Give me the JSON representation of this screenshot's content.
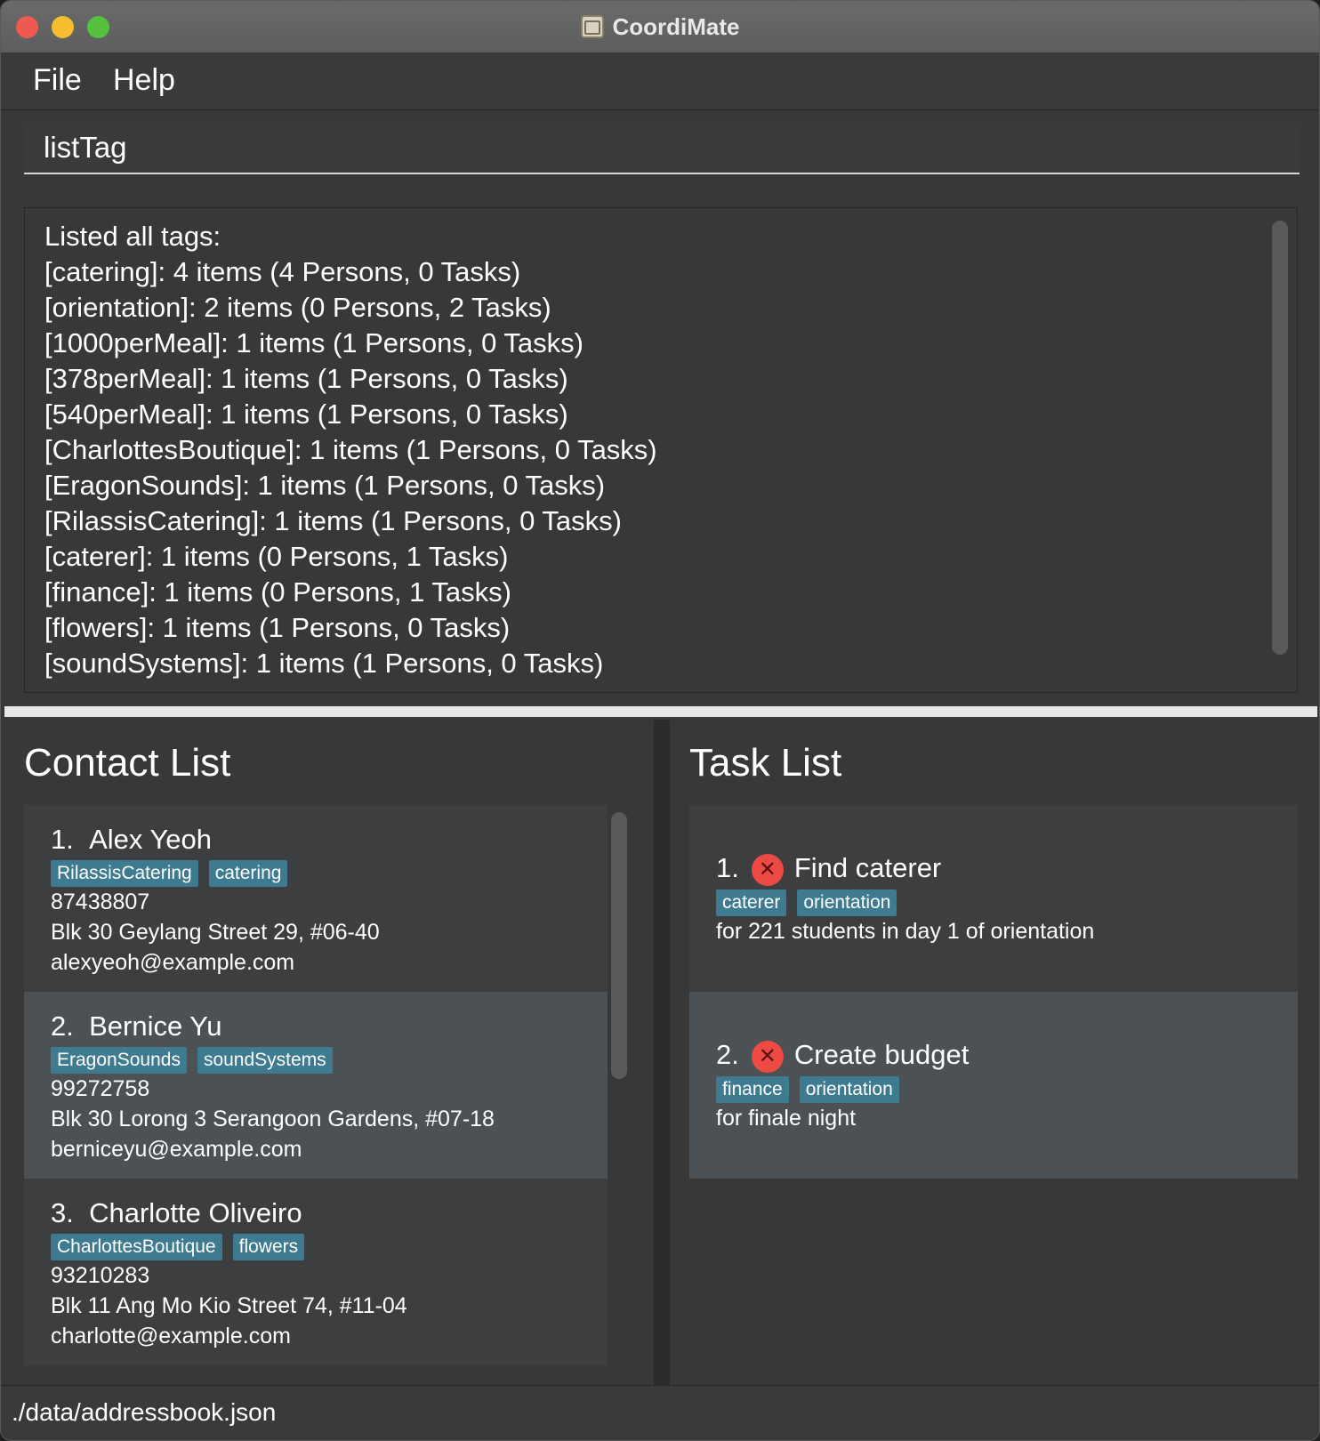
{
  "window": {
    "title": "CoordiMate"
  },
  "menu": {
    "file": "File",
    "help": "Help"
  },
  "command": {
    "value": "listTag"
  },
  "result": {
    "lines": [
      "Listed all tags:",
      "[catering]: 4 items (4 Persons, 0 Tasks)",
      "[orientation]: 2 items (0 Persons, 2 Tasks)",
      "[1000perMeal]: 1 items (1 Persons, 0 Tasks)",
      "[378perMeal]: 1 items (1 Persons, 0 Tasks)",
      "[540perMeal]: 1 items (1 Persons, 0 Tasks)",
      "[CharlottesBoutique]: 1 items (1 Persons, 0 Tasks)",
      "[EragonSounds]: 1 items (1 Persons, 0 Tasks)",
      "[RilassisCatering]: 1 items (1 Persons, 0 Tasks)",
      "[caterer]: 1 items (0 Persons, 1 Tasks)",
      "[finance]: 1 items (0 Persons, 1 Tasks)",
      "[flowers]: 1 items (1 Persons, 0 Tasks)",
      "[soundSystems]: 1 items (1 Persons, 0 Tasks)"
    ]
  },
  "contacts": {
    "title": "Contact List",
    "items": [
      {
        "index": "1.",
        "name": "Alex Yeoh",
        "tags": [
          "RilassisCatering",
          "catering"
        ],
        "phone": "87438807",
        "address": "Blk 30 Geylang Street 29, #06-40",
        "email": "alexyeoh@example.com"
      },
      {
        "index": "2.",
        "name": "Bernice Yu",
        "tags": [
          "EragonSounds",
          "soundSystems"
        ],
        "phone": "99272758",
        "address": "Blk 30 Lorong 3 Serangoon Gardens, #07-18",
        "email": "berniceyu@example.com"
      },
      {
        "index": "3.",
        "name": "Charlotte Oliveiro",
        "tags": [
          "CharlottesBoutique",
          "flowers"
        ],
        "phone": "93210283",
        "address": "Blk 11 Ang Mo Kio Street 74, #11-04",
        "email": "charlotte@example.com"
      }
    ]
  },
  "tasks": {
    "title": "Task List",
    "status_icon": "cross-circle-icon",
    "status_color": "#ee4a44",
    "items": [
      {
        "index": "1.",
        "name": "Find caterer",
        "status": "✕",
        "tags": [
          "caterer",
          "orientation"
        ],
        "note": "for 221 students in day 1 of orientation"
      },
      {
        "index": "2.",
        "name": "Create budget",
        "status": "✕",
        "tags": [
          "finance",
          "orientation"
        ],
        "note": "for finale night"
      }
    ]
  },
  "status_bar": {
    "path": "./data/addressbook.json"
  },
  "colors": {
    "tag": "#3e7b91",
    "card_dark": "#3c3e3f",
    "card_light": "#4b5154"
  }
}
